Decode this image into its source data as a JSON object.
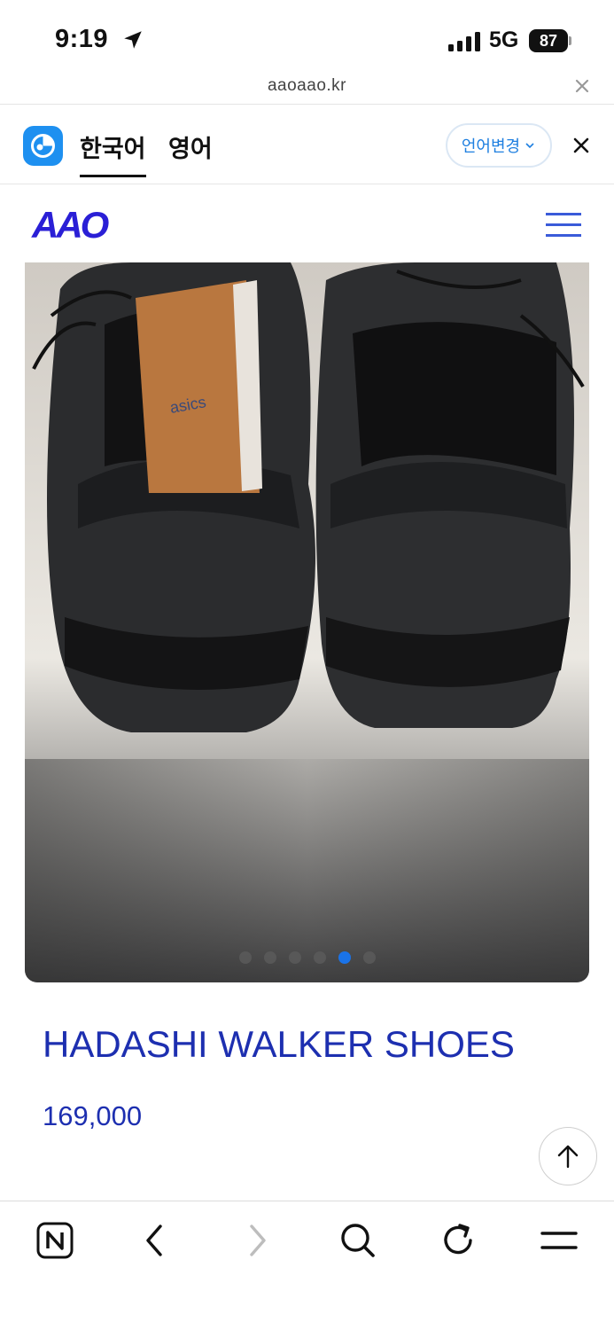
{
  "status_bar": {
    "time": "9:19",
    "network": "5G",
    "battery": "87",
    "icons": [
      "location-arrow-icon",
      "signal-bars-icon",
      "battery-icon"
    ]
  },
  "url_bar": {
    "url": "aaoaao.kr",
    "close_icon": "close-icon"
  },
  "translate_bar": {
    "app_icon": "papago-translate-icon",
    "tabs": [
      {
        "label": "한국어",
        "active": true
      },
      {
        "label": "영어",
        "active": false
      }
    ],
    "change_language_label": "언어변경",
    "close_icon": "close-icon"
  },
  "site_header": {
    "logo": "AAO",
    "menu_icon": "hamburger-menu-icon"
  },
  "product": {
    "image_alt": "black asics sneakers",
    "carousel": {
      "total": 6,
      "active_index": 4
    },
    "name": "HADASHI WALKER SHOES",
    "price": "169,000"
  },
  "scroll_top_icon": "arrow-up-icon",
  "bottom_toolbar": {
    "items": [
      {
        "icon": "naver-home-icon"
      },
      {
        "icon": "back-arrow-icon"
      },
      {
        "icon": "forward-arrow-icon"
      },
      {
        "icon": "search-icon"
      },
      {
        "icon": "refresh-icon"
      },
      {
        "icon": "menu-icon"
      }
    ]
  },
  "colors": {
    "brand_blue": "#2a1fd6",
    "text_blue": "#1d2fb0",
    "accent_blue": "#1e7fe0",
    "active_dot": "#1a73e8"
  }
}
